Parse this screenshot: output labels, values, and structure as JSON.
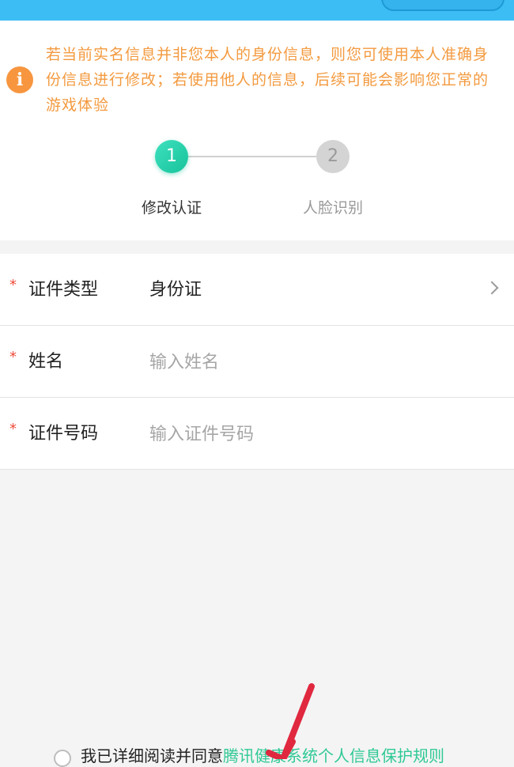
{
  "notice": {
    "icon": "info-icon",
    "icon_glyph": "i",
    "text": "若当前实名信息并非您本人的身份信息，则您可使用本人准确身份信息进行修改；若使用他人的信息，后续可能会影响您正常的游戏体验"
  },
  "steps": [
    {
      "number": "1",
      "label": "修改认证"
    },
    {
      "number": "2",
      "label": "人脸识别"
    }
  ],
  "form": {
    "required_mark": "*",
    "id_type": {
      "label": "证件类型",
      "value": "身份证"
    },
    "name": {
      "label": "姓名",
      "placeholder": "输入姓名"
    },
    "id_number": {
      "label": "证件号码",
      "placeholder": "输入证件号码"
    }
  },
  "agreement": {
    "text": "我已详细阅读并同意",
    "link": "腾讯健康系统个人信息保护规则"
  },
  "colors": {
    "header": "#3cbef5",
    "notice": "#f39a3f",
    "step_active": "#17c39b",
    "required": "#f04a3a",
    "link": "#2fc995",
    "arrow": "#e0283f"
  }
}
